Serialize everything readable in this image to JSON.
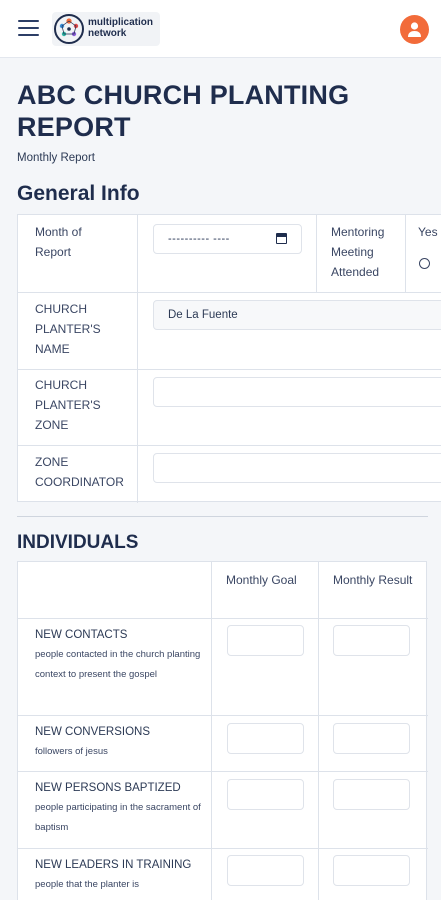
{
  "header": {
    "menu_icon": "hamburger-menu-icon",
    "logo_text_line1": "multiplication",
    "logo_text_line2": "network",
    "avatar_icon": "user-icon",
    "accent_color": "#f26b3a"
  },
  "page": {
    "title": "ABC CHURCH PLANTING REPORT",
    "subtitle": "Monthly Report"
  },
  "general_info": {
    "heading": "General Info",
    "month_label": "Month of Report",
    "month_value": "---------- ----",
    "mentoring_label": "Mentoring Meeting Attended",
    "mentoring_yes": "Yes",
    "planter_name_label": "CHURCH PLANTER'S NAME",
    "planter_name_value": "De La Fuente",
    "planter_zone_label": "CHURCH PLANTER'S ZONE",
    "planter_zone_value": "",
    "zone_coordinator_label": "ZONE COORDINATOR",
    "zone_coordinator_value": ""
  },
  "individuals": {
    "heading": "INDIVIDUALS",
    "col_goal": "Monthly Goal",
    "col_result": "Monthly Result",
    "rows": [
      {
        "title": "NEW CONTACTS",
        "desc": "people contacted in the church planting context to present the gospel"
      },
      {
        "title": "NEW CONVERSIONS",
        "desc": "followers of jesus"
      },
      {
        "title": "NEW PERSONS BAPTIZED",
        "desc": "people participating in the sacrament of baptism"
      },
      {
        "title": "NEW LEADERS IN TRAINING",
        "desc": "people that the planter is"
      }
    ]
  }
}
